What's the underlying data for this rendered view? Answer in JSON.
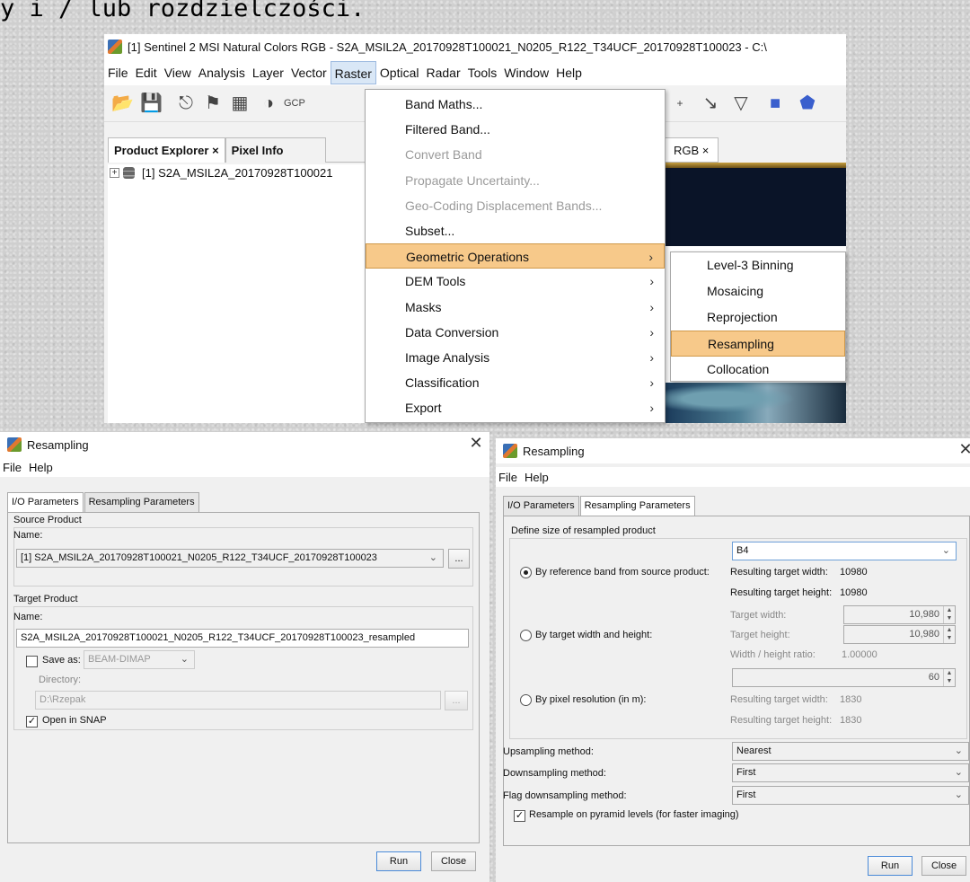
{
  "slide_heading": "y i / lub rozdzielczości.",
  "snap": {
    "title": "[1] Sentinel 2 MSI Natural Colors RGB - S2A_MSIL2A_20170928T100021_N0205_R122_T34UCF_20170928T100023 - C:\\",
    "menu": [
      "File",
      "Edit",
      "View",
      "Analysis",
      "Layer",
      "Vector",
      "Raster",
      "Optical",
      "Radar",
      "Tools",
      "Window",
      "Help"
    ],
    "active_menu": "Raster",
    "toolbar_icons": [
      "open-product-icon",
      "save-product-icon",
      "pin-icon",
      "magic-wand-icon",
      "graticule-icon",
      "spectrum-icon",
      "gcp-icon"
    ],
    "panel_tabs": [
      "Product Explorer ×",
      "Pixel Info"
    ],
    "tree_item": "[1] S2A_MSIL2A_20170928T100021",
    "image_tab": "RGB ×",
    "raster_menu": [
      {
        "label": "Band Maths...",
        "enabled": true,
        "submenu": false
      },
      {
        "label": "Filtered Band...",
        "enabled": true,
        "submenu": false
      },
      {
        "label": "Convert Band",
        "enabled": false,
        "submenu": false
      },
      {
        "label": "Propagate Uncertainty...",
        "enabled": false,
        "submenu": false
      },
      {
        "label": "Geo-Coding Displacement Bands...",
        "enabled": false,
        "submenu": false
      },
      {
        "label": "Subset...",
        "enabled": true,
        "submenu": false
      },
      {
        "label": "Geometric Operations",
        "enabled": true,
        "submenu": true,
        "highlighted": true
      },
      {
        "label": "DEM Tools",
        "enabled": true,
        "submenu": true
      },
      {
        "label": "Masks",
        "enabled": true,
        "submenu": true
      },
      {
        "label": "Data Conversion",
        "enabled": true,
        "submenu": true
      },
      {
        "label": "Image Analysis",
        "enabled": true,
        "submenu": true
      },
      {
        "label": "Classification",
        "enabled": true,
        "submenu": true
      },
      {
        "label": "Export",
        "enabled": true,
        "submenu": true
      }
    ],
    "geometric_submenu": [
      "Level-3 Binning",
      "Mosaicing",
      "Reprojection",
      "Resampling",
      "Collocation"
    ],
    "submenu_highlight": "Resampling"
  },
  "dlg_io": {
    "title": "Resampling",
    "menu": [
      "File",
      "Help"
    ],
    "tabs": [
      "I/O Parameters",
      "Resampling Parameters"
    ],
    "source_group": "Source Product",
    "source_name_label": "Name:",
    "source_name_value": "[1] S2A_MSIL2A_20170928T100021_N0205_R122_T34UCF_20170928T100023",
    "browse_label": "...",
    "target_group": "Target Product",
    "target_name_label": "Name:",
    "target_name_value": "S2A_MSIL2A_20170928T100021_N0205_R122_T34UCF_20170928T100023_resampled",
    "save_as_label": "Save as:",
    "save_format": "BEAM-DIMAP",
    "directory_label": "Directory:",
    "directory_value": "D:\\Rzepak",
    "open_in_snap_label": "Open in SNAP",
    "open_in_snap_checked": true,
    "save_as_checked": false,
    "run_label": "Run",
    "close_label": "Close"
  },
  "dlg_rp": {
    "title": "Resampling",
    "menu": [
      "File",
      "Help"
    ],
    "tabs": [
      "I/O Parameters",
      "Resampling Parameters"
    ],
    "define_group": "Define size of resampled product",
    "ref_band_value": "B4",
    "opt_ref_band": "By reference band from source product:",
    "ref_width_label": "Resulting target width:",
    "ref_width_value": "10980",
    "ref_height_label": "Resulting target height:",
    "ref_height_value": "10980",
    "opt_width_height": "By target width and height:",
    "target_width_label": "Target width:",
    "target_width_value": "10,980",
    "target_height_label": "Target height:",
    "target_height_value": "10,980",
    "ratio_label": "Width / height ratio:",
    "ratio_value": "1.00000",
    "opt_pixel_res": "By pixel resolution (in m):",
    "pixel_res_value": "60",
    "res_width_label": "Resulting target width:",
    "res_width_value": "1830",
    "res_height_label": "Resulting target height:",
    "res_height_value": "1830",
    "upsampling_label": "Upsampling method:",
    "upsampling_value": "Nearest",
    "downsampling_label": "Downsampling method:",
    "downsampling_value": "First",
    "flag_downsampling_label": "Flag downsampling method:",
    "flag_downsampling_value": "First",
    "pyramid_label": "Resample on pyramid levels (for faster imaging)",
    "pyramid_checked": true,
    "selected_option": "By reference band from source product:",
    "run_label": "Run",
    "close_label": "Close"
  },
  "colors": {
    "menu_highlight": "#f7c98a",
    "run_border": "#4a8ad8"
  }
}
